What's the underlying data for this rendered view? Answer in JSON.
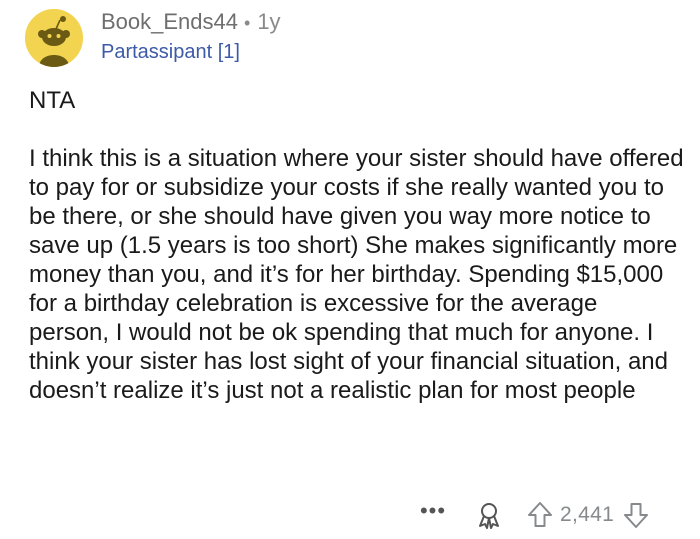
{
  "comment": {
    "author": "Book_Ends44",
    "separator": "•",
    "age": "1y",
    "flair": "Partassipant [1]",
    "verdict": "NTA",
    "body": "I think this is a situation where your sister should have offered to pay for or subsidize your costs if she really wanted you to be there, or she should have given you way more notice to save up (1.5 years is too short) She makes significantly more money than you, and it’s for her birthday. Spending $15,000 for a birthday celebration is excessive for the average person, I would not be ok spending that much for anyone. I think your sister has lost sight of your financial situation, and doesn’t realize it’s just not a realistic plan for most people"
  },
  "actions": {
    "more_label": "•••",
    "score": "2,441",
    "icons": {
      "more": "more-options-icon",
      "award": "award-icon",
      "upvote": "upvote-arrow-icon",
      "downvote": "downvote-arrow-icon"
    }
  },
  "colors": {
    "avatar_bg": "#f2d450",
    "flair": "#3d5aa8",
    "meta_gray": "#8a8a8a",
    "icon_gray": "#878a8c"
  }
}
